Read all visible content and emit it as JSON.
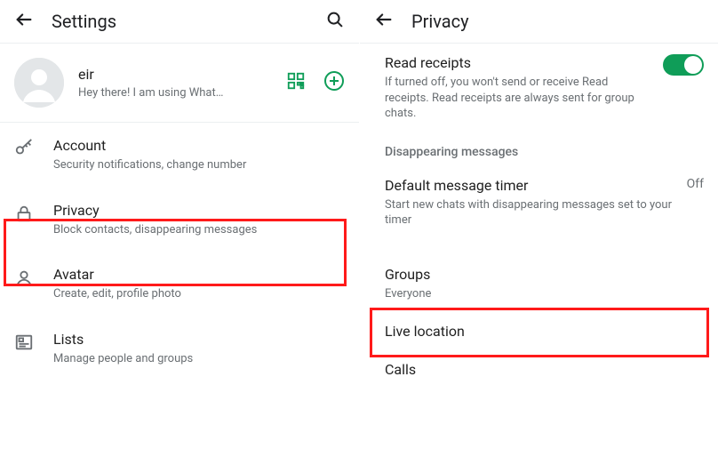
{
  "left": {
    "title": "Settings",
    "profile": {
      "name": "eir",
      "status": "Hey there! I am using What…"
    },
    "items": [
      {
        "title": "Account",
        "sub": "Security notifications, change number"
      },
      {
        "title": "Privacy",
        "sub": "Block contacts, disappearing messages"
      },
      {
        "title": "Avatar",
        "sub": "Create, edit, profile photo"
      },
      {
        "title": "Lists",
        "sub": "Manage people and groups"
      }
    ]
  },
  "right": {
    "title": "Privacy",
    "read_receipts": {
      "title": "Read receipts",
      "sub": "If turned off, you won't send or receive Read receipts. Read receipts are always sent for group chats."
    },
    "section_disappearing": "Disappearing messages",
    "default_timer": {
      "title": "Default message timer",
      "sub": "Start new chats with disappearing messages set to your timer",
      "value": "Off"
    },
    "groups": {
      "title": "Groups",
      "sub": "Everyone"
    },
    "live_location": {
      "title": "Live location"
    },
    "calls": {
      "title": "Calls"
    }
  }
}
